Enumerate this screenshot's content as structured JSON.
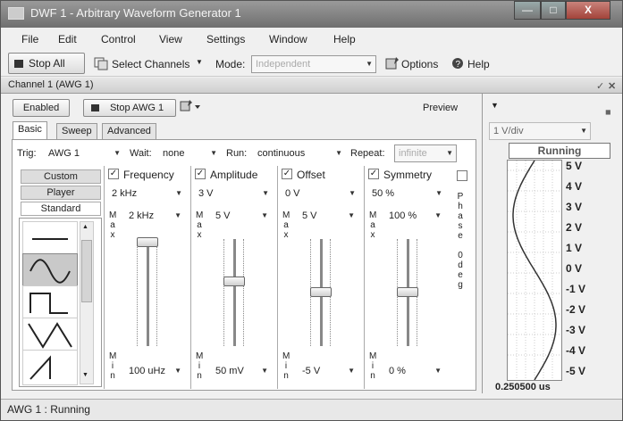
{
  "window": {
    "title": "DWF 1 - Arbitrary Waveform Generator 1",
    "min": "—",
    "max": "□",
    "close": "X"
  },
  "menu": [
    "File",
    "Edit",
    "Control",
    "View",
    "Settings",
    "Window",
    "Help"
  ],
  "toolbar": {
    "stop_all": "Stop All",
    "select_channels": "Select Channels",
    "mode_label": "Mode:",
    "mode_value": "Independent",
    "options": "Options",
    "help": "Help"
  },
  "channel": {
    "header": "Channel 1 (AWG 1)",
    "enabled": "Enabled",
    "stop": "Stop AWG 1",
    "preview": "Preview",
    "tabs": [
      "Basic",
      "Sweep",
      "Advanced"
    ],
    "trig_label": "Trig:",
    "trig_value": "AWG 1",
    "wait_label": "Wait:",
    "wait_value": "none",
    "run_label": "Run:",
    "run_value": "continuous",
    "repeat_label": "Repeat:",
    "repeat_value": "infinite"
  },
  "waveform_tabs": [
    "Custom",
    "Player",
    "Standard"
  ],
  "waveforms": [
    "dc-icon",
    "sine-icon",
    "square-icon",
    "triangle-icon",
    "ramp-up-icon"
  ],
  "params": [
    {
      "name": "Frequency",
      "value": "2 kHz",
      "max": "2 kHz",
      "min": "100 uHz",
      "level": 0.97
    },
    {
      "name": "Amplitude",
      "value": "3 V",
      "max": "5 V",
      "min": "50 mV",
      "level": 0.6
    },
    {
      "name": "Offset",
      "value": "0 V",
      "max": "5 V",
      "min": "-5 V",
      "level": 0.5
    },
    {
      "name": "Symmetry",
      "value": "50 %",
      "max": "100 %",
      "min": "0 %",
      "level": 0.5
    }
  ],
  "max_letters": [
    "M",
    "a",
    "x"
  ],
  "min_letters": [
    "M",
    "i",
    "n"
  ],
  "phase_letters": [
    "P",
    "h",
    "a",
    "s",
    "e",
    "",
    "0",
    "d",
    "e",
    "g"
  ],
  "preview": {
    "vdiv": "1 V/div",
    "status": "Running",
    "time_label": "0.250500 us"
  },
  "y_ticks": [
    "5 V",
    "4 V",
    "3 V",
    "2 V",
    "1 V",
    "0 V",
    "-1 V",
    "-2 V",
    "-3 V",
    "-4 V",
    "-5 V"
  ],
  "status": "AWG 1 : Running"
}
